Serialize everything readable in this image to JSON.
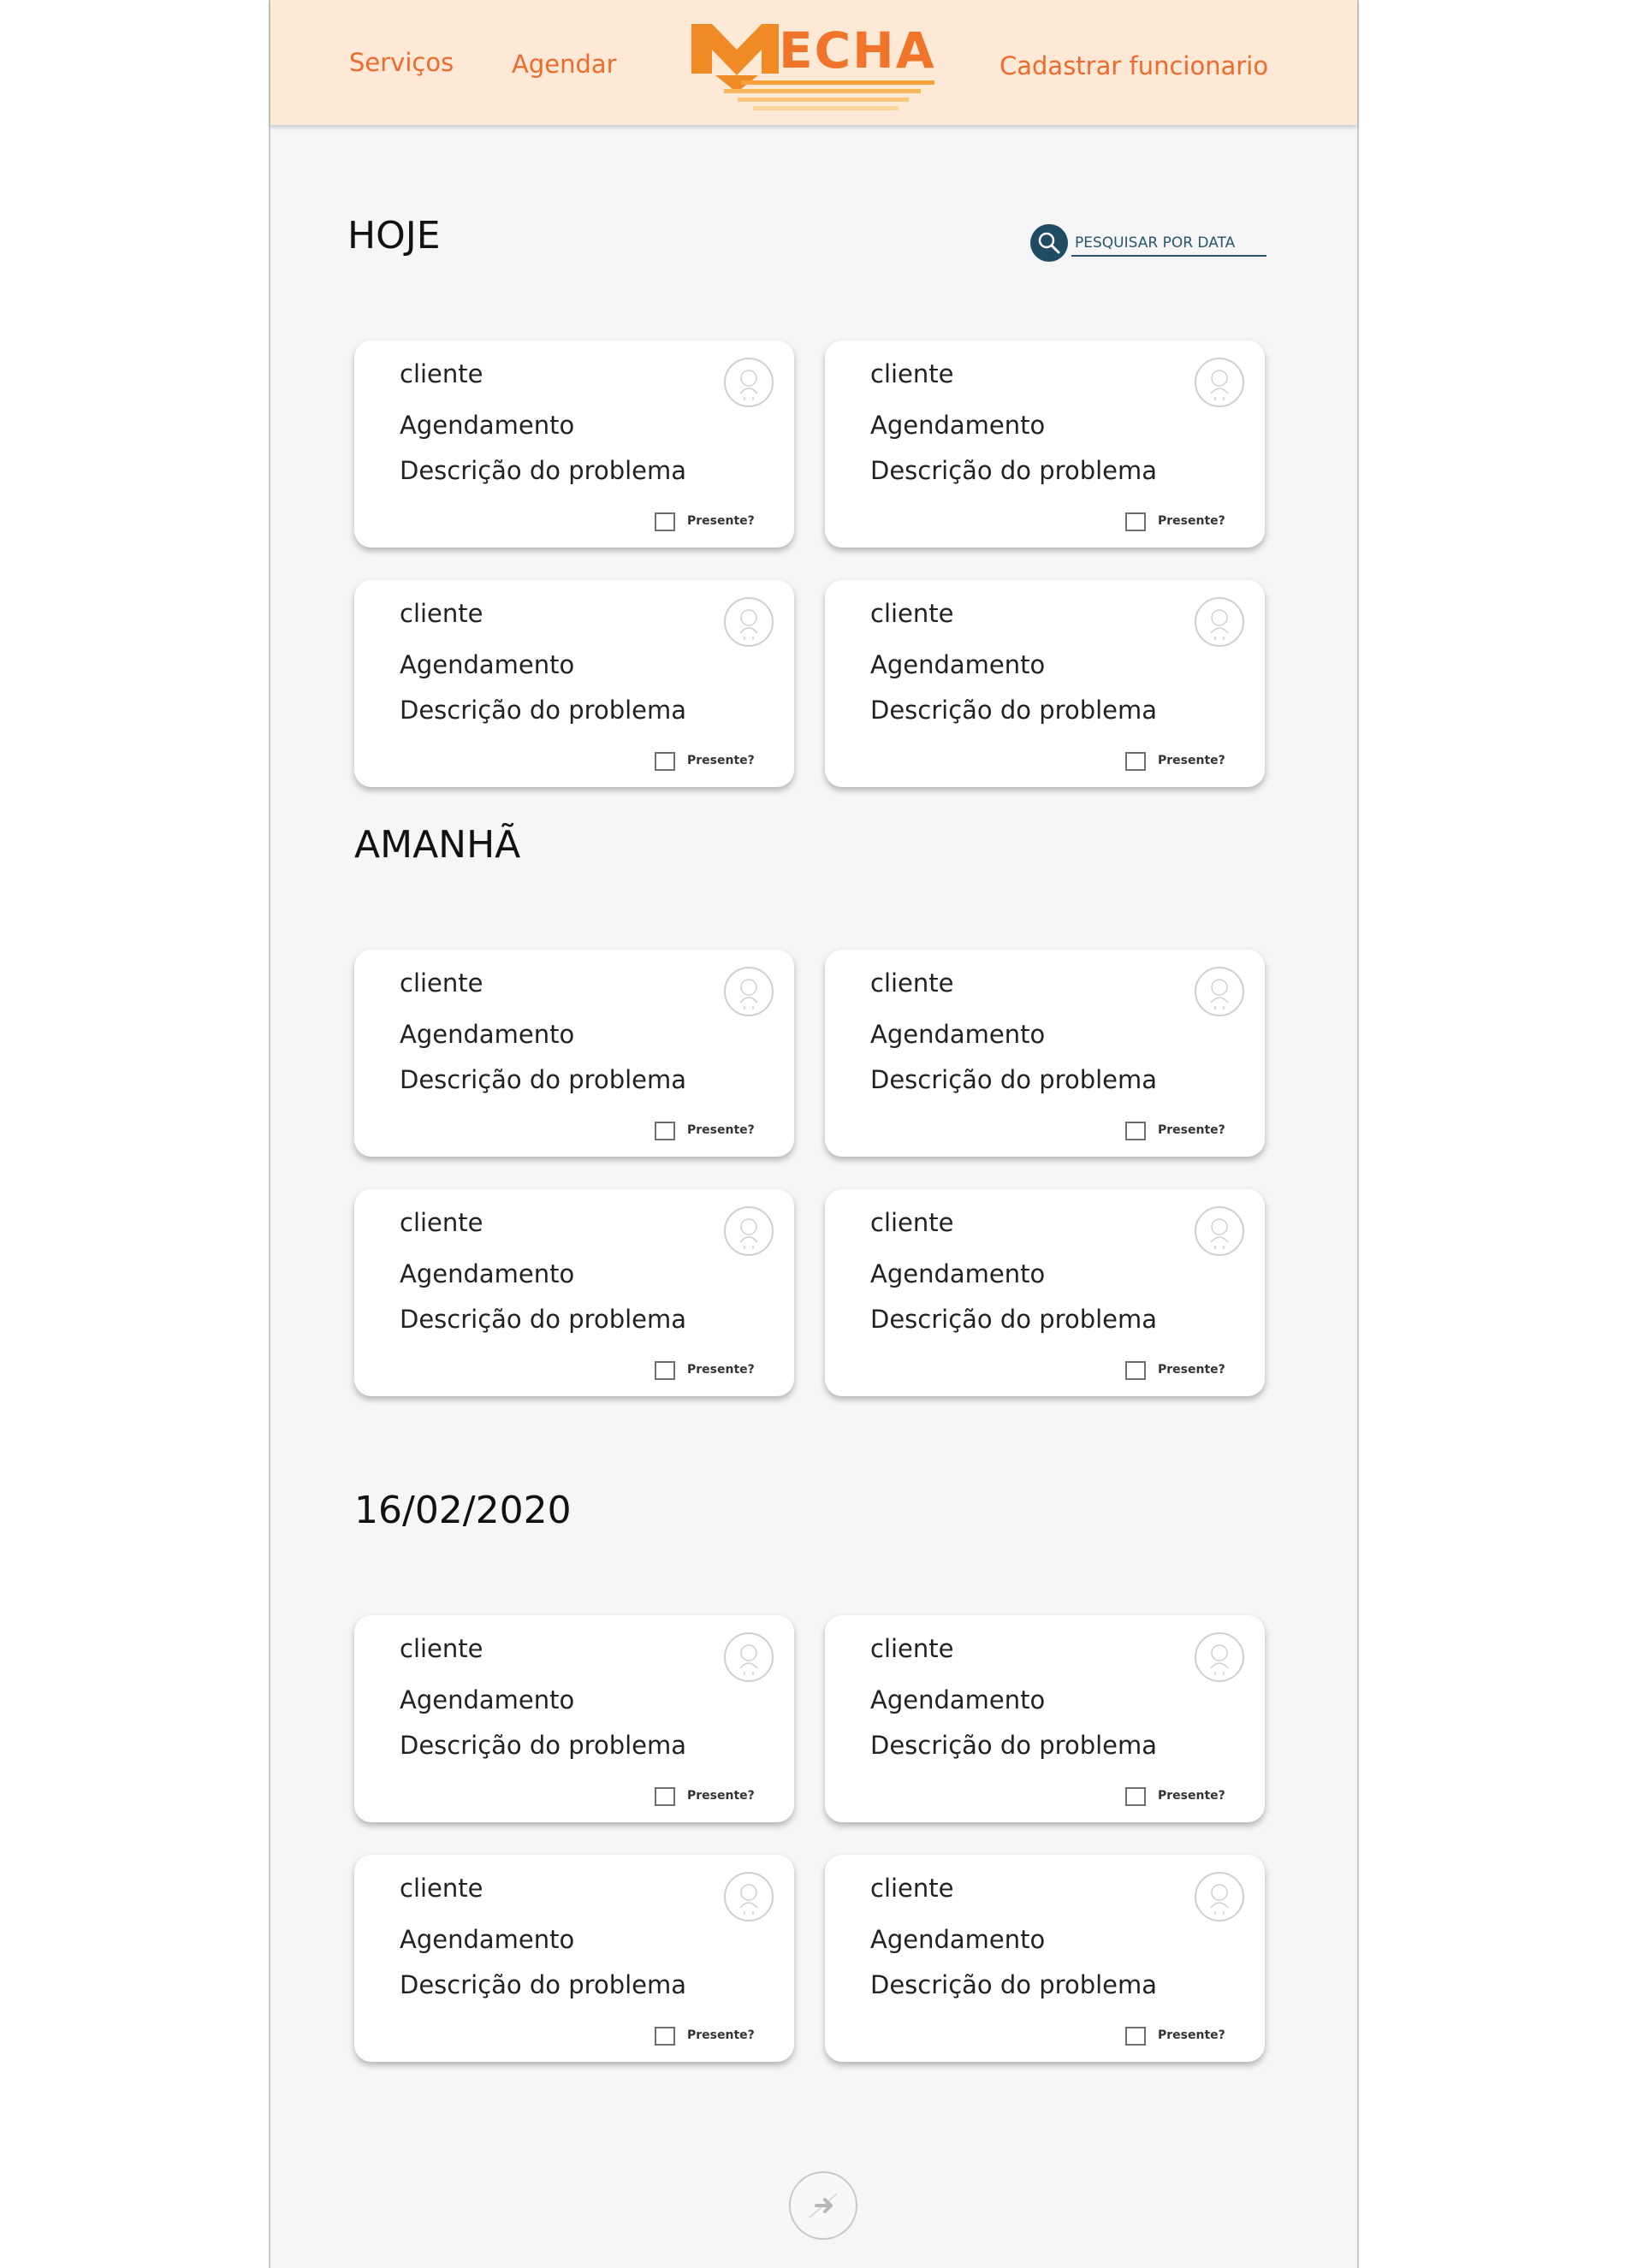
{
  "header": {
    "nav": {
      "servicos": "Serviços",
      "agendar": "Agendar",
      "cadastrar": "Cadastrar funcionario"
    },
    "logo": {
      "text": "MECHA",
      "icon": "mecha-logo"
    }
  },
  "search": {
    "label": "PESQUISAR POR DATA",
    "icon": "search-icon"
  },
  "sections": [
    {
      "title": "HOJE",
      "cards": [
        {
          "client": "cliente",
          "schedule": "Agendamento",
          "description": "Descrição do problema",
          "present_label": "Presente?"
        },
        {
          "client": "cliente",
          "schedule": "Agendamento",
          "description": "Descrição do problema",
          "present_label": "Presente?"
        },
        {
          "client": "cliente",
          "schedule": "Agendamento",
          "description": "Descrição do problema",
          "present_label": "Presente?"
        },
        {
          "client": "cliente",
          "schedule": "Agendamento",
          "description": "Descrição do problema",
          "present_label": "Presente?"
        }
      ]
    },
    {
      "title": "AMANHÃ",
      "cards": [
        {
          "client": "cliente",
          "schedule": "Agendamento",
          "description": "Descrição do problema",
          "present_label": "Presente?"
        },
        {
          "client": "cliente",
          "schedule": "Agendamento",
          "description": "Descrição do problema",
          "present_label": "Presente?"
        },
        {
          "client": "cliente",
          "schedule": "Agendamento",
          "description": "Descrição do problema",
          "present_label": "Presente?"
        },
        {
          "client": "cliente",
          "schedule": "Agendamento",
          "description": "Descrição do problema",
          "present_label": "Presente?"
        }
      ]
    },
    {
      "title": "16/02/2020",
      "cards": [
        {
          "client": "cliente",
          "schedule": "Agendamento",
          "description": "Descrição do problema",
          "present_label": "Presente?"
        },
        {
          "client": "cliente",
          "schedule": "Agendamento",
          "description": "Descrição do problema",
          "present_label": "Presente?"
        },
        {
          "client": "cliente",
          "schedule": "Agendamento",
          "description": "Descrição do problema",
          "present_label": "Presente?"
        },
        {
          "client": "cliente",
          "schedule": "Agendamento",
          "description": "Descrição do problema",
          "present_label": "Presente?"
        }
      ]
    }
  ],
  "pagination": {
    "next_icon": "arrow-right-icon"
  },
  "colors": {
    "accent": "#ef6a2c",
    "header_bg": "#fde9d6",
    "search_accent": "#1f4c63",
    "page_bg": "#f6f6f6"
  }
}
